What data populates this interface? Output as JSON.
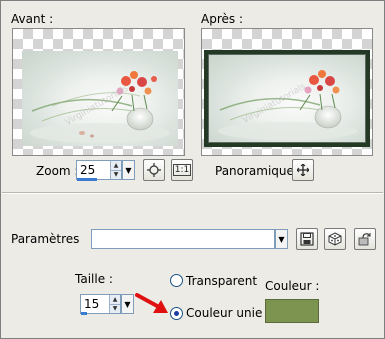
{
  "labels": {
    "avant": "Avant :",
    "apres": "Après :",
    "zoom": "Zoom :",
    "panoramique": "Panoramique :",
    "parametres": "Paramètres",
    "taille": "Taille :",
    "transparent": "Transparent",
    "couleur_unie": "Couleur unie",
    "couleur": "Couleur :"
  },
  "zoom": {
    "value": "25",
    "fill": 0.45
  },
  "taille": {
    "value": "15",
    "fill": 0.1
  },
  "fill_mode_selected": "Couleur unie",
  "couleur_value": "#7d9451",
  "icons": [
    "pan-crosshair-icon",
    "zoom-fit-icon",
    "zoom-actual-icon",
    "save-preset-icon",
    "randomize-dice-icon",
    "reset-icon",
    "red-arrow-icon",
    "watermark"
  ]
}
